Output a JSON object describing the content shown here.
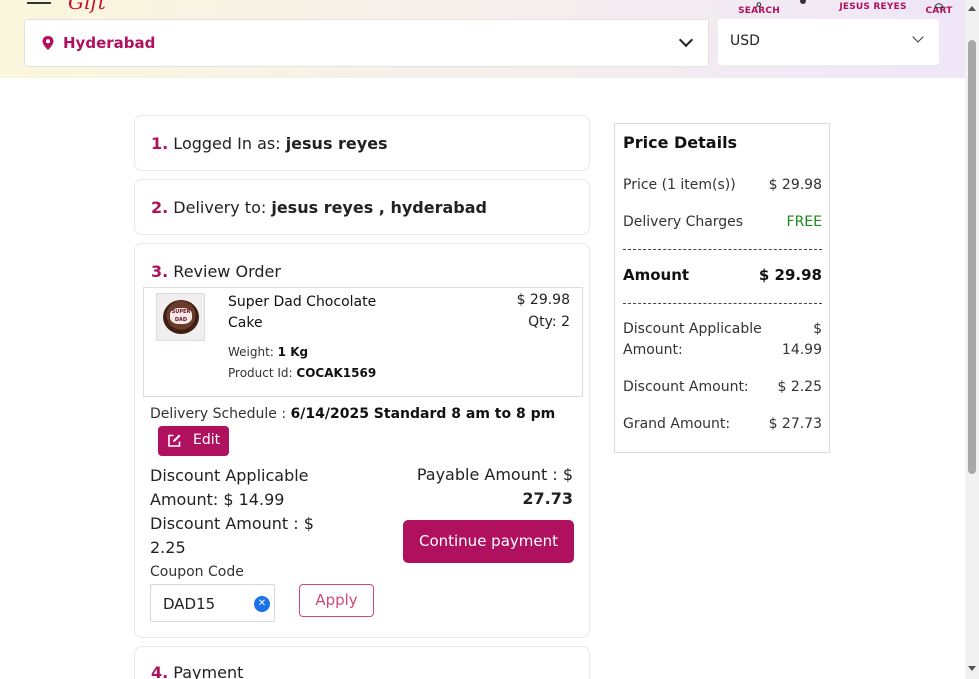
{
  "header": {
    "search_label": "SEARCH",
    "user_label": "JESUS REYES",
    "cart_label": "CART",
    "location": "Hyderabad",
    "currency": "USD"
  },
  "steps": {
    "s1_num": "1.",
    "s1_text": " Logged In as: ",
    "s1_value": "jesus reyes",
    "s2_num": "2.",
    "s2_text": " Delivery to: ",
    "s2_value": "jesus reyes ,  hyderabad",
    "s3_num": "3.",
    "s3_text": " Review Order",
    "s4_num": "4.",
    "s4_text": " Payment"
  },
  "product": {
    "name": "Super Dad Chocolate Cake",
    "price": "$ 29.98",
    "qty": "Qty: 2",
    "weight_label": "Weight: ",
    "weight_value": "1 Kg",
    "id_label": "Product Id: ",
    "id_value": "COCAK1569",
    "image_text": "SUPER DAD"
  },
  "review": {
    "schedule_label": "Delivery Schedule : ",
    "schedule_value": "6/14/2025 Standard 8 am to 8 pm",
    "edit_label": "Edit",
    "discount_applicable_line1": "Discount Applicable",
    "discount_applicable_line2": "Amount:  $  14.99",
    "discount_amount_line1": "Discount Amount :  $",
    "discount_amount_line2": "2.25",
    "payable_line1": "Payable Amount :  $",
    "payable_value": "27.73",
    "continue_label": "Continue payment",
    "coupon_label": "Coupon Code",
    "coupon_value": "DAD15",
    "apply_label": "Apply"
  },
  "price_details": {
    "title": "Price Details",
    "price_label": "Price (1 item(s))",
    "price_value": "$  29.98",
    "delivery_label": "Delivery Charges",
    "delivery_value": "FREE",
    "amount_label": "Amount",
    "amount_value": "$  29.98",
    "disc_app_label1": "Discount Applicable",
    "disc_app_label2": "Amount:",
    "disc_app_value1": "$",
    "disc_app_value2": "14.99",
    "disc_amt_label": "Discount Amount:",
    "disc_amt_value": "$  2.25",
    "grand_label": "Grand Amount:",
    "grand_value": "$  27.73"
  },
  "colors": {
    "brand": "#b0115f",
    "free": "#1a8a1a"
  }
}
